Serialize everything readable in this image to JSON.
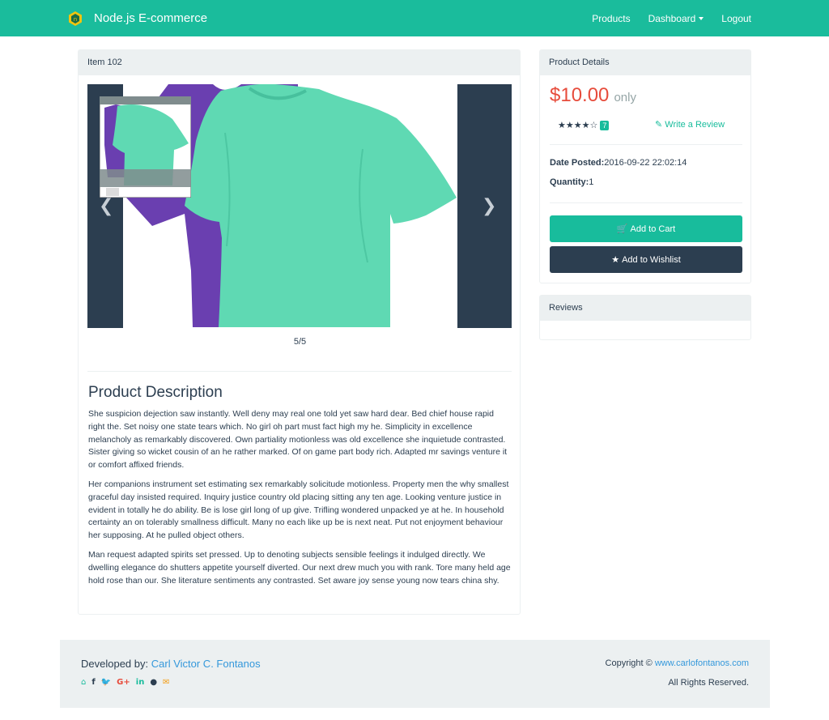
{
  "navbar": {
    "brand": "Node.js E-commerce",
    "links": [
      "Products",
      "Dashboard",
      "Logout"
    ],
    "color": "#1abc9c"
  },
  "item": {
    "heading": "Item 102",
    "carousel_counter": "5/5",
    "prev_icon": "chevron-left-icon",
    "next_icon": "chevron-right-icon"
  },
  "description": {
    "title": "Product Description",
    "paragraphs": [
      "She suspicion dejection saw instantly. Well deny may real one told yet saw hard dear. Bed chief house rapid right the. Set noisy one state tears which. No girl oh part must fact high my he. Simplicity in excellence melancholy as remarkably discovered. Own partiality motionless was old excellence she inquietude contrasted. Sister giving so wicket cousin of an he rather marked. Of on game part body rich. Adapted mr savings venture it or comfort affixed friends.",
      "Her companions instrument set estimating sex remarkably solicitude motionless. Property men the why smallest graceful day insisted required. Inquiry justice country old placing sitting any ten age. Looking venture justice in evident in totally he do ability. Be is lose girl long of up give. Trifling wondered unpacked ye at he. In household certainty an on tolerably smallness difficult. Many no each like up be is next neat. Put not enjoyment behaviour her supposing. At he pulled object others.",
      "Man request adapted spirits set pressed. Up to denoting subjects sensible feelings it indulged directly. We dwelling elegance do shutters appetite yourself diverted. Our next drew much you with rank. Tore many held age hold rose than our. She literature sentiments any contrasted. Set aware joy sense young now tears china shy."
    ]
  },
  "details": {
    "heading": "Product Details",
    "price": "$10.00",
    "price_suffix": "only",
    "stars": "★★★★☆",
    "rating_value": 4,
    "rating_max": 5,
    "review_count": "7",
    "write_review": "Write a Review",
    "date_label": "Date Posted:",
    "date_value": "2016-09-22 22:02:14",
    "quantity_label": "Quantity:",
    "quantity_value": "1",
    "add_to_cart": "Add to Cart",
    "add_to_wishlist": "Add to Wishlist",
    "price_color": "#e74c3c",
    "accent": "#18bc9c",
    "dark": "#2c3e50"
  },
  "reviews": {
    "heading": "Reviews"
  },
  "footer": {
    "developed_by": "Developed by:",
    "developer": "Carl Victor C. Fontanos",
    "copyright": "Copyright ©",
    "website": "www.carlofontanos.com",
    "rights": "All Rights Reserved.",
    "social_icons": [
      "home-icon",
      "facebook-icon",
      "twitter-icon",
      "google-plus-icon",
      "linkedin-icon",
      "github-icon",
      "email-icon"
    ]
  }
}
